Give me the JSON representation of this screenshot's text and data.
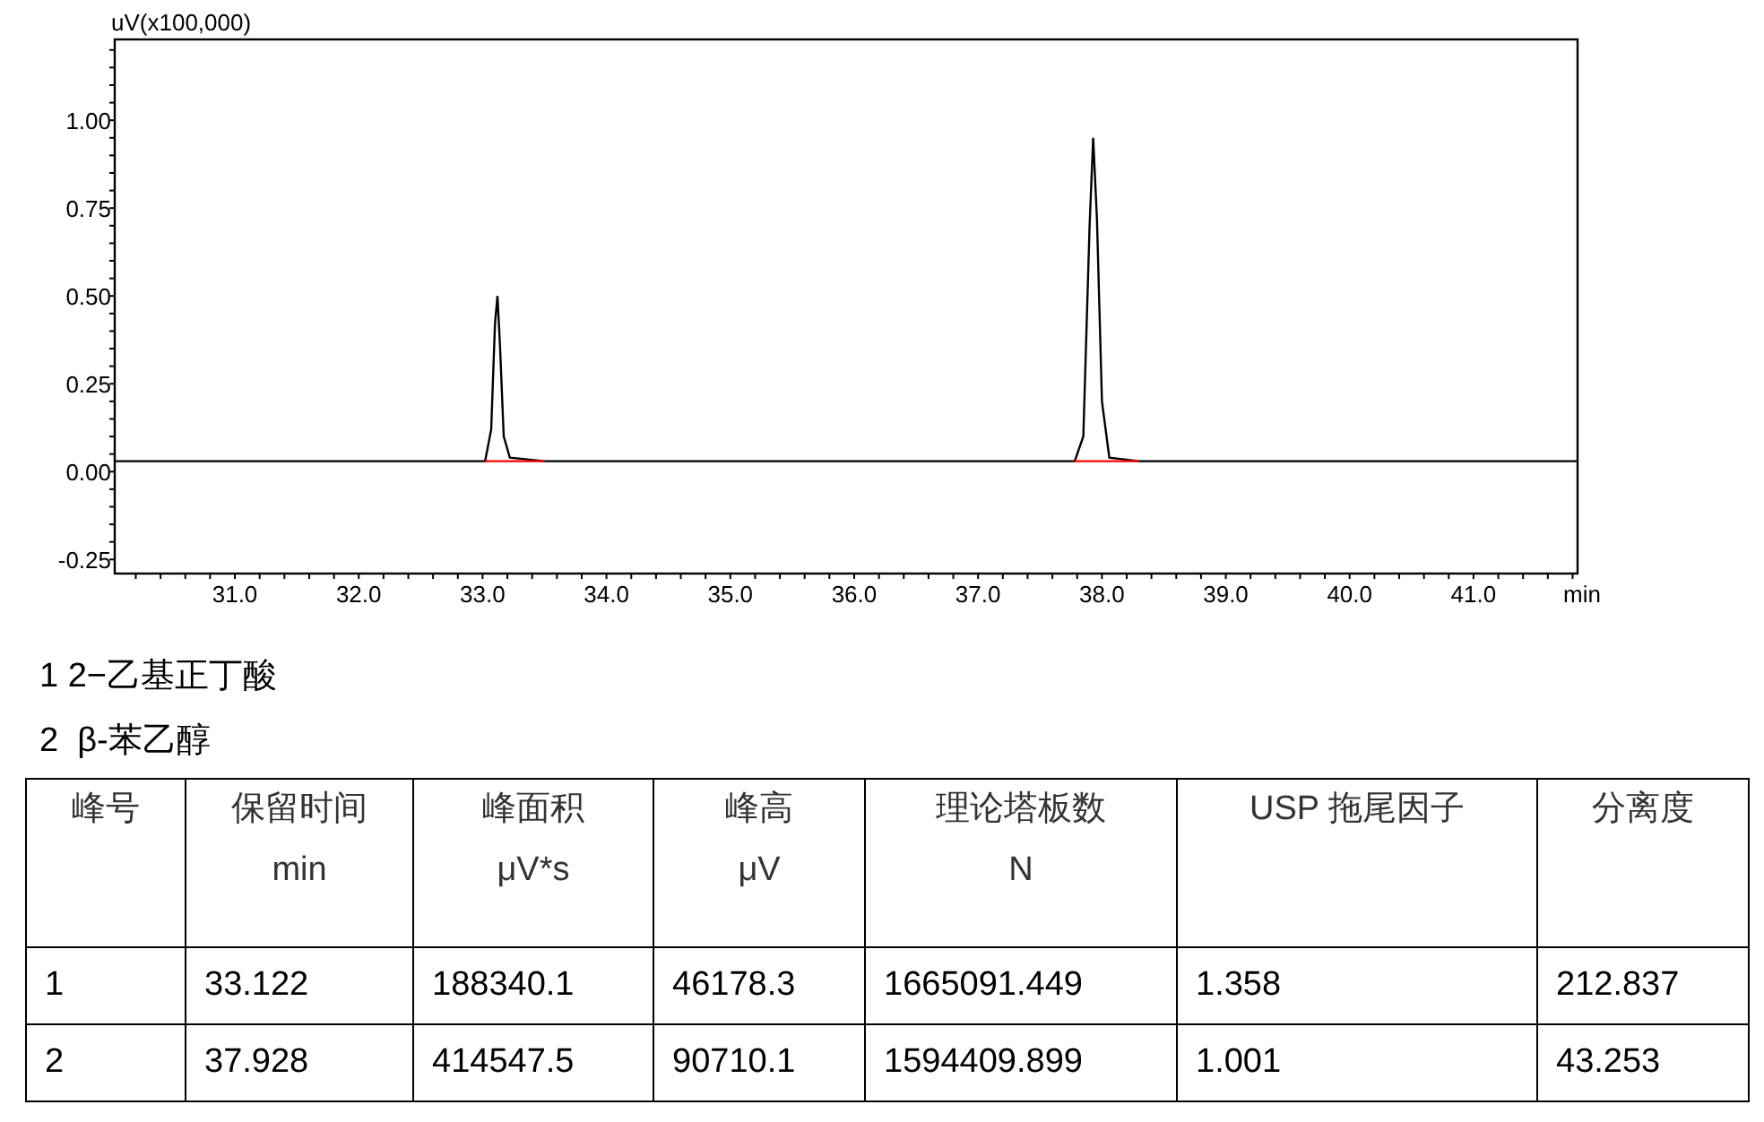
{
  "chromatogram": {
    "chart_data": {
      "type": "line",
      "ylabel": "uV(x100,000)",
      "xlabel": "min",
      "xlim": [
        30.03,
        41.84
      ],
      "ylim": [
        -0.29,
        1.23
      ],
      "xticks": [
        {
          "value": 31,
          "label": "31.0"
        },
        {
          "value": 32,
          "label": "32.0"
        },
        {
          "value": 33,
          "label": "33.0"
        },
        {
          "value": 34,
          "label": "34.0"
        },
        {
          "value": 35,
          "label": "35.0"
        },
        {
          "value": 36,
          "label": "36.0"
        },
        {
          "value": 37,
          "label": "37.0"
        },
        {
          "value": 38,
          "label": "38.0"
        },
        {
          "value": 39,
          "label": "39.0"
        },
        {
          "value": 40,
          "label": "40.0"
        },
        {
          "value": 41,
          "label": "41.0"
        }
      ],
      "yticks": [
        {
          "value": -0.25,
          "label": "-0.25"
        },
        {
          "value": 0,
          "label": "0.00"
        },
        {
          "value": 0.25,
          "label": "0.25"
        },
        {
          "value": 0.5,
          "label": "0.50"
        },
        {
          "value": 0.75,
          "label": "0.75"
        },
        {
          "value": 1,
          "label": "1.00"
        }
      ],
      "x": [
        30.03,
        33.02,
        33.07,
        33.1,
        33.12,
        33.14,
        33.17,
        33.22,
        33.5,
        35.5,
        37.78,
        37.85,
        37.9,
        37.93,
        37.96,
        38.0,
        38.06,
        38.3,
        41.84
      ],
      "series": [
        {
          "color": "#000000",
          "values": [
            0.03,
            0.03,
            0.12,
            0.42,
            0.5,
            0.36,
            0.1,
            0.04,
            0.03,
            0.03,
            0.03,
            0.1,
            0.7,
            0.95,
            0.72,
            0.2,
            0.04,
            0.03,
            0.03
          ]
        },
        {
          "color": "#ff0000",
          "values": [
            null,
            0.03,
            0.03,
            0.03,
            0.03,
            0.03,
            0.03,
            0.03,
            0.03,
            null,
            0.03,
            0.03,
            0.03,
            0.03,
            0.03,
            0.03,
            0.03,
            0.03,
            null
          ]
        }
      ]
    }
  },
  "peak_names": [
    "1 2−乙基正丁酸",
    "2  β-苯乙醇"
  ],
  "table": {
    "columns": [
      {
        "label": "峰号"
      },
      {
        "label": "保留时间",
        "unit": "min"
      },
      {
        "label": "峰面积",
        "unit": "μV*s"
      },
      {
        "label": "峰高",
        "unit": "μV"
      },
      {
        "label": "理论塔板数",
        "unit": "N"
      },
      {
        "label": "USP 拖尾因子"
      },
      {
        "label": "分离度"
      }
    ],
    "rows": [
      [
        "1",
        "33.122",
        "188340.1",
        "46178.3",
        "1665091.449",
        "1.358",
        "212.837"
      ],
      [
        "2",
        "37.928",
        "414547.5",
        "90710.1",
        "1594409.899",
        "1.001",
        "43.253"
      ]
    ]
  }
}
